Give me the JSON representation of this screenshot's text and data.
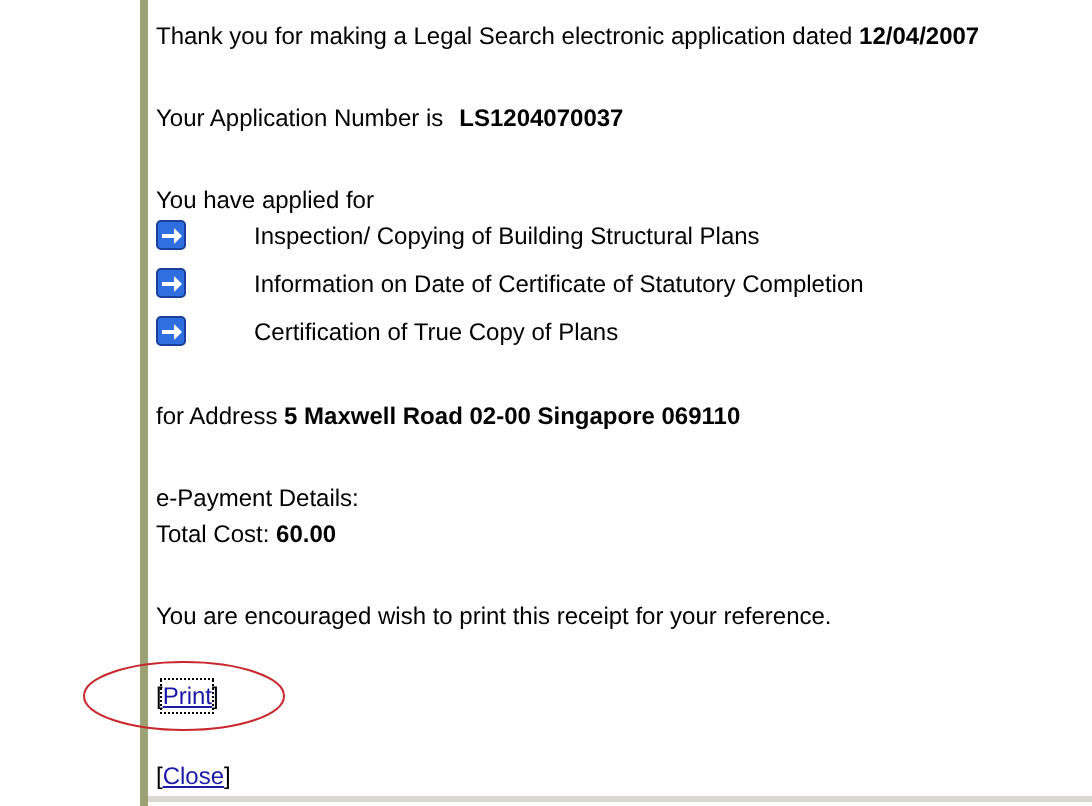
{
  "intro": "Thank you for making a Legal Search electronic application dated **12/04/2007**",
  "application_number": {
    "label": "Your Application Number is",
    "value": "LS1204070037"
  },
  "applied_for": {
    "label": "You have applied for",
    "items": [
      "Inspection/ Copying of Building Structural Plans",
      "Information on Date of Certificate of Statutory Completion",
      "Certification of True Copy of Plans"
    ]
  },
  "address": "for Address **5 Maxwell Road 02-00 Singapore 069110**",
  "payment": {
    "heading": "e-Payment Details:",
    "total": "Total Cost: **60.00**"
  },
  "notice": "You are encouraged wish to print this receipt for your reference.",
  "links": [
    {
      "open": "[",
      "label": "Print",
      "close": "]",
      "focused": true,
      "circled": true
    },
    {
      "open": "[",
      "label": "Close",
      "close": "]",
      "focused": false,
      "circled": false
    }
  ]
}
